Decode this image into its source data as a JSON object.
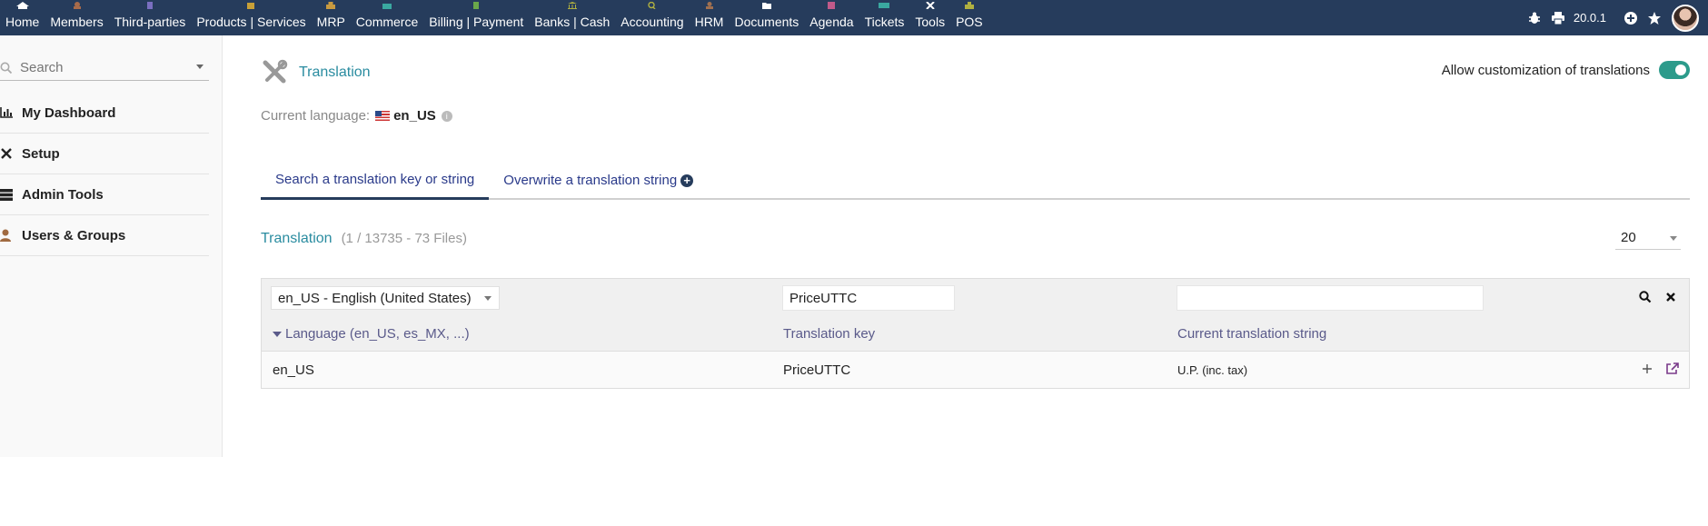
{
  "topbar": {
    "menu": [
      {
        "label": "Home",
        "icon": "home-icon"
      },
      {
        "label": "Members",
        "icon": "members-icon"
      },
      {
        "label": "Third-parties",
        "icon": "building-icon"
      },
      {
        "label": "Products | Services",
        "icon": "box-icon"
      },
      {
        "label": "MRP",
        "icon": "cubes-icon"
      },
      {
        "label": "Commerce",
        "icon": "suitcase-icon"
      },
      {
        "label": "Billing | Payment",
        "icon": "invoice-icon"
      },
      {
        "label": "Banks | Cash",
        "icon": "bank-icon"
      },
      {
        "label": "Accounting",
        "icon": "search-dollar-icon"
      },
      {
        "label": "HRM",
        "icon": "user-tie-icon"
      },
      {
        "label": "Documents",
        "icon": "folder-icon"
      },
      {
        "label": "Agenda",
        "icon": "calendar-icon"
      },
      {
        "label": "Tickets",
        "icon": "ticket-icon"
      },
      {
        "label": "Tools",
        "icon": "tools-icon"
      },
      {
        "label": "POS",
        "icon": "cash-register-icon"
      }
    ],
    "version": "20.0.1"
  },
  "sidebar": {
    "search_placeholder": "Search",
    "items": [
      {
        "label": "My Dashboard",
        "icon": "chart-bar-icon"
      },
      {
        "label": "Setup",
        "icon": "tools-icon"
      },
      {
        "label": "Admin Tools",
        "icon": "server-icon"
      },
      {
        "label": "Users & Groups",
        "icon": "user-icon"
      }
    ]
  },
  "page": {
    "title": "Translation",
    "allow_label": "Allow customization of translations",
    "current_language_label": "Current language:",
    "current_language": "en_US",
    "tabs": [
      {
        "label": "Search a translation key or string",
        "active": true
      },
      {
        "label": "Overwrite a translation string",
        "active": false
      }
    ],
    "section_title": "Translation",
    "section_count": "(1 / 13735 - 73 Files)",
    "page_size": "20"
  },
  "table": {
    "filter": {
      "language": "en_US - English (United States)",
      "key": "PriceUTTC",
      "translation": ""
    },
    "headers": {
      "language": "Language (en_US, es_MX, ...)",
      "key": "Translation key",
      "translation": "Current translation string"
    },
    "rows": [
      {
        "language": "en_US",
        "key": "PriceUTTC",
        "translation": "U.P. (inc. tax)"
      }
    ]
  },
  "colors": {
    "topbar": "#263c5c",
    "accent": "#2a8ca0",
    "toggle_on": "#2c9b8b"
  }
}
